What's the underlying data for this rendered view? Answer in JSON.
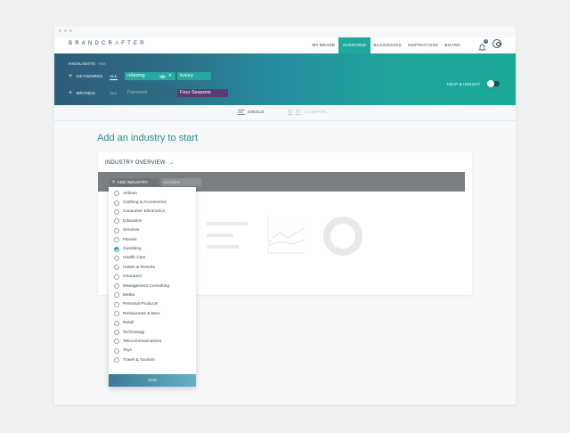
{
  "app": {
    "logo_prefix": "BRANDCR",
    "logo_accent": "A",
    "logo_suffix": "FTER",
    "accent_color": "#20a89d"
  },
  "nav": {
    "items": [
      {
        "label": "MY BRAND",
        "state": "normal"
      },
      {
        "label": "OVERVIEW",
        "state": "active"
      },
      {
        "label": "BUSINESSES",
        "state": "normal"
      },
      {
        "label": "INSPIRATIONS",
        "state": "normal"
      },
      {
        "label": "BOARD",
        "state": "normal"
      }
    ],
    "notification_count": "3"
  },
  "highlights": {
    "title": "HIGHLIGHTS",
    "hide_label": "HIDE",
    "keywords_label": "KEYWORDS",
    "keywords_all": "ALL",
    "keyword_chips": [
      "relaxing",
      "luxury"
    ],
    "brands_label": "BRANDS",
    "brands_all": "ALL",
    "brand_chips": [
      "Fairmont",
      "Four Seasons"
    ],
    "help_label": "HELP & INSIGHT"
  },
  "modes": {
    "single": "SINGLE",
    "compare": "COMPARE",
    "selected": "single"
  },
  "main": {
    "heading": "Add an industry to start"
  },
  "card": {
    "title": "INDUSTRY OVERVIEW",
    "add_industry": "ADD INDUSTRY",
    "global": "GLOBAL"
  },
  "dropdown": {
    "options": [
      {
        "label": "Airlines",
        "checked": false
      },
      {
        "label": "Clothing & Accessories",
        "checked": false
      },
      {
        "label": "Consumer Electronics",
        "checked": false
      },
      {
        "label": "Education",
        "checked": false
      },
      {
        "label": "Services",
        "checked": false
      },
      {
        "label": "Fitness",
        "checked": false
      },
      {
        "label": "Gambling",
        "checked": true
      },
      {
        "label": "Health Care",
        "checked": false
      },
      {
        "label": "Hotels & Resorts",
        "checked": false
      },
      {
        "label": "Insurance",
        "checked": false
      },
      {
        "label": "Management Consulting",
        "checked": false
      },
      {
        "label": "Media",
        "checked": false
      },
      {
        "label": "Personal Products",
        "checked": false
      },
      {
        "label": "Restaurants & Bars",
        "checked": false
      },
      {
        "label": "Retail",
        "checked": false
      },
      {
        "label": "Technology",
        "checked": false
      },
      {
        "label": "Telecommunications",
        "checked": false
      },
      {
        "label": "Toys",
        "checked": false
      },
      {
        "label": "Travel & Tourism",
        "checked": false
      }
    ],
    "add_label": "ADD"
  }
}
